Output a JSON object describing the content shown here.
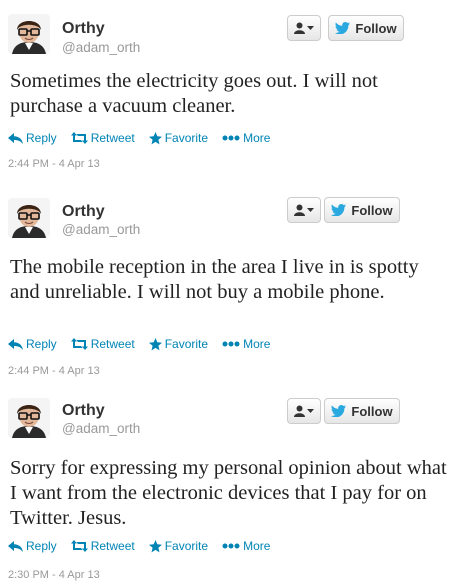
{
  "colors": {
    "link": "#0084b4",
    "twitter_blue": "#2aa9e0",
    "muted": "#999999",
    "text": "#222222"
  },
  "tweets": [
    {
      "name": "Orthy",
      "handle": "@adam_orth",
      "text": "Sometimes the electricity goes out. I will not purchase a vacuum cleaner.",
      "actions": {
        "reply": "Reply",
        "retweet": "Retweet",
        "favorite": "Favorite",
        "more": "More"
      },
      "follow_label": "Follow",
      "timestamp": "2:44 PM - 4 Apr 13"
    },
    {
      "name": "Orthy",
      "handle": "@adam_orth",
      "text": "The mobile reception in the area I live in is spotty and unreliable. I will not buy a mobile phone.",
      "actions": {
        "reply": "Reply",
        "retweet": "Retweet",
        "favorite": "Favorite",
        "more": "More"
      },
      "follow_label": "Follow",
      "timestamp": "2:44 PM - 4 Apr 13"
    },
    {
      "name": "Orthy",
      "handle": "@adam_orth",
      "text": "Sorry for expressing my personal opinion about what I want from the electronic devices that I pay for on Twitter. Jesus.",
      "actions": {
        "reply": "Reply",
        "retweet": "Retweet",
        "favorite": "Favorite",
        "more": "More"
      },
      "follow_label": "Follow",
      "timestamp": "2:30 PM - 4 Apr 13"
    }
  ]
}
